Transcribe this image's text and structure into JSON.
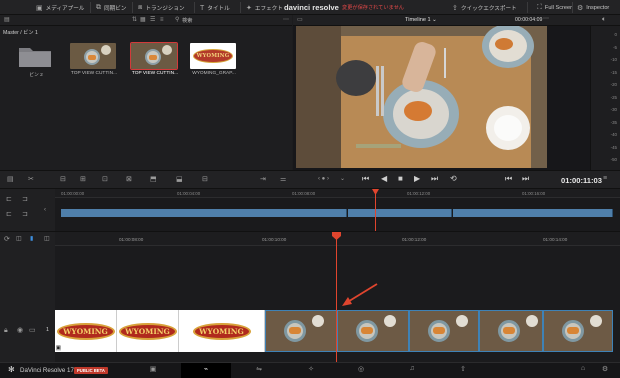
{
  "toolbar": {
    "media_pool": "メディアプール",
    "sync_bin": "同期ビン",
    "transitions": "トランジション",
    "titles": "タイトル",
    "effects": "エフェクト",
    "app_title": "davinci resolve",
    "unsaved_notice": "変更が保存されていません",
    "quick_export": "クイックエクスポート",
    "full_screen": "Full Screen",
    "inspector": "Inspector"
  },
  "media_pool": {
    "search_label": "検索",
    "path": "Master / ビン 1",
    "clips": [
      {
        "name": "ビン 2",
        "kind": "folder"
      },
      {
        "name": "TOP VIEW CUTTIN...",
        "kind": "video"
      },
      {
        "name": "TOP VIEW CUTTIN...",
        "kind": "video",
        "selected": true
      },
      {
        "name": "WYOMING_GRAP...",
        "kind": "graphic",
        "logo_text": "WYOMING"
      }
    ]
  },
  "viewer": {
    "timeline_name": "Timeline 1",
    "timecode_top": "00:00:04:09",
    "meter_ticks": [
      "0",
      "-5",
      "-10",
      "-15",
      "-20",
      "-25",
      "-30",
      "-35",
      "-40",
      "-45",
      "-50"
    ]
  },
  "transport": {
    "timecode": "01:00:11:03"
  },
  "overview_ruler": [
    "01:00:00:00",
    "01:00:04:00",
    "01:00:08:00",
    "01:00:12:00",
    "01:00:16:00"
  ],
  "timeline_ruler": [
    "01:00:08:00",
    "01:00:10:00",
    "01:00:12:00",
    "01:00:14:00"
  ],
  "track": {
    "number": "1",
    "logo_text": "WYOMING"
  },
  "pagebar": {
    "brand": "DaVinci Resolve 17",
    "beta": "PUBLIC BETA"
  },
  "colors": {
    "accent_red": "#e0452e",
    "clip_blue": "#4f7faa",
    "unsaved_red": "#e04848"
  }
}
